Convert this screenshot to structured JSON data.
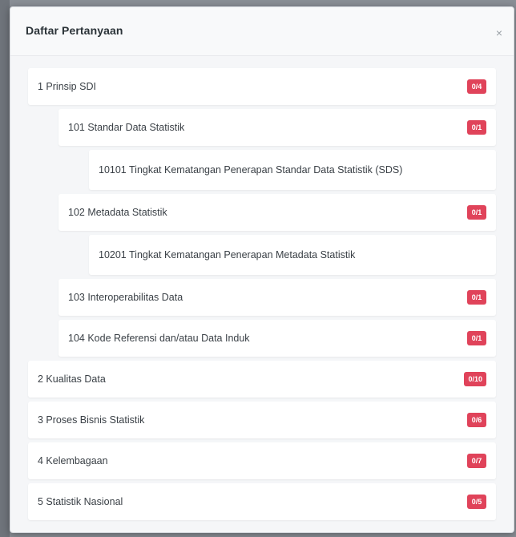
{
  "modal": {
    "title": "Daftar Pertanyaan",
    "close_glyph": "×"
  },
  "items": [
    {
      "label": "1 Prinsip SDI",
      "badge": "0/4"
    },
    {
      "label": "101 Standar Data Statistik",
      "badge": "0/1"
    },
    {
      "label": "10101 Tingkat Kematangan Penerapan Standar Data Statistik (SDS)",
      "badge": ""
    },
    {
      "label": "102 Metadata Statistik",
      "badge": "0/1"
    },
    {
      "label": "10201 Tingkat Kematangan Penerapan Metadata Statistik",
      "badge": ""
    },
    {
      "label": "103 Interoperabilitas Data",
      "badge": "0/1"
    },
    {
      "label": "104 Kode Referensi dan/atau Data Induk",
      "badge": "0/1"
    },
    {
      "label": "2 Kualitas Data",
      "badge": "0/10"
    },
    {
      "label": "3 Proses Bisnis Statistik",
      "badge": "0/6"
    },
    {
      "label": "4 Kelembagaan",
      "badge": "0/7"
    },
    {
      "label": "5 Statistik Nasional",
      "badge": "0/5"
    }
  ]
}
